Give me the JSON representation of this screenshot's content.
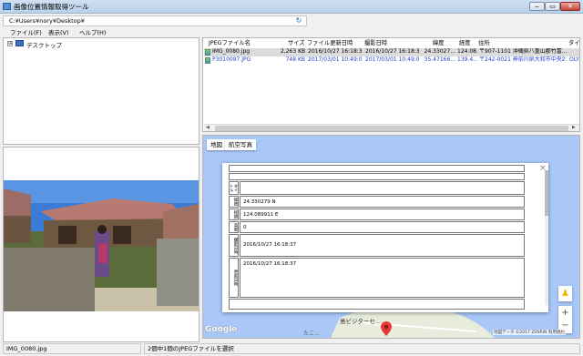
{
  "window": {
    "title": "画像位置情報取得ツール"
  },
  "path_bar": {
    "path": "C:¥Users¥nory¥Desktop¥",
    "refresh_icon": "refresh-icon"
  },
  "menu": {
    "items": [
      "ファイル(F)",
      "表示(V)",
      "ヘルプ(H)"
    ]
  },
  "tree": {
    "root_label": "デスクトップ",
    "expander": "⊞"
  },
  "file_list": {
    "columns": [
      "JPEGファイル名",
      "サイズ",
      "ファイル更新日時",
      "撮影日時",
      "緯度",
      "経度",
      "住所",
      "タイト"
    ],
    "rows": [
      {
        "name": "IMG_0080.jpg",
        "size": "2,263 KB",
        "modified": "2016/10/27 16:18:37",
        "taken": "2016/10/27 16:18:37",
        "lat": "24.33027...",
        "lng": "124.08...",
        "address": "〒907-1101 沖縄県八重山郡竹富...",
        "title": ""
      },
      {
        "name": "P3010097.JPG",
        "size": "748 KB",
        "modified": "2017/03/01 10:49:03",
        "taken": "2017/03/01 10:49:03",
        "lat": "35.47166...",
        "lng": "139.4...",
        "address": "〒242-0021 神奈川県大和市中央2...",
        "title": "OLYI"
      }
    ]
  },
  "map": {
    "tabs": [
      "地図",
      "航空写真"
    ],
    "info_fields": [
      {
        "label": "タイトル",
        "value": ""
      },
      {
        "label": "緯度",
        "value": "24.330279 N"
      },
      {
        "label": "経度",
        "value": "124.089911 E"
      },
      {
        "label": "高度",
        "value": "0"
      },
      {
        "label": "撮影日時",
        "value": "2016/10/27 16:18:37"
      },
      {
        "label": "更新日時",
        "value": "2016/10/27 16:18:37"
      }
    ],
    "place_labels": [
      "島ビジターセ...",
      "たこ..."
    ],
    "google_label": "Google",
    "copyright": "地図データ ©2017 ZENRIN  利用規約",
    "zoom_in": "+",
    "zoom_out": "−",
    "close": "×"
  },
  "status": {
    "left": "IMG_0080.jpg",
    "right": "2個中1個のJPEGファイルを選択"
  },
  "colors": {
    "selected_row": "#dcdcdc",
    "link_blue": "#1f3fd0",
    "map_water": "#a9c8f7"
  }
}
